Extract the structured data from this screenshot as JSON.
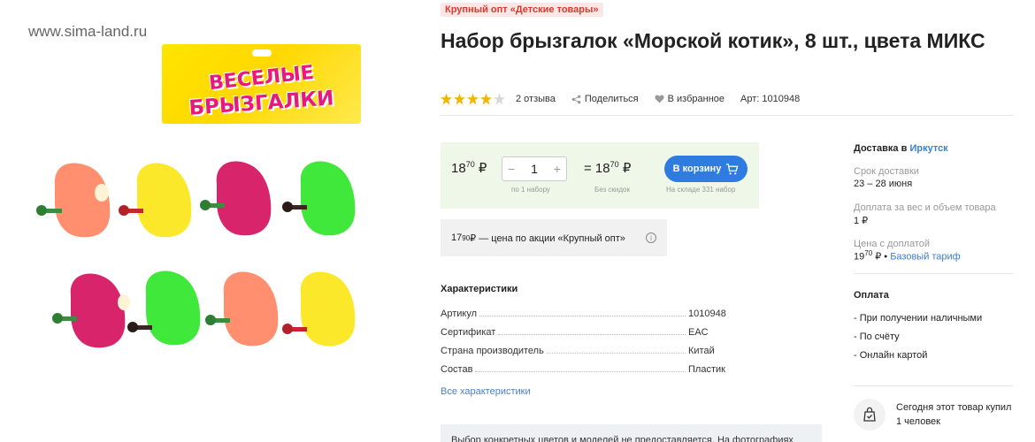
{
  "image": {
    "watermark": "www.sima-land.ru",
    "pack_title_line1": "ВЕСЕЛЫЕ",
    "pack_title_line2": "БРЫЗГАЛКИ"
  },
  "badge": "Крупный опт «Детские товары»",
  "product": {
    "title": "Набор брызгалок «Морской котик», 8 шт., цвета МИКС",
    "rating": 4,
    "rating_max": 5,
    "reviews": "2 отзыва",
    "share": "Поделиться",
    "favorite": "В избранное",
    "article": "Арт: 1010948"
  },
  "buy": {
    "price_int": "18",
    "price_frac": "70",
    "currency": "₽",
    "qty": "1",
    "minus": "−",
    "plus": "+",
    "total_prefix": "= 18",
    "total_frac": "70",
    "cart_label": "В корзину",
    "per_label": "по 1 набору",
    "discount_label": "Без скидок",
    "stock_label": "На складе 331 набор"
  },
  "promo": {
    "price_int": "17",
    "price_frac": "90",
    "text": " ₽ — цена по акции «Крупный опт»",
    "info": "i"
  },
  "characteristics": {
    "title": "Характеристики",
    "rows": [
      {
        "key": "Артикул",
        "value": "1010948"
      },
      {
        "key": "Сертификат",
        "value": "EAC"
      },
      {
        "key": "Страна производитель",
        "value": "Китай"
      },
      {
        "key": "Состав",
        "value": "Пластик"
      }
    ],
    "all_link": "Все характеристики"
  },
  "notice": "Выбор конкретных цветов и моделей не предоставляется. На фотографиях",
  "delivery": {
    "title_prefix": "Доставка в",
    "city": "Иркутск",
    "term_label": "Срок доставки",
    "term_value": "23 – 28 июня",
    "surcharge_label": "Доплата за вес и объем товара",
    "surcharge_value": "1 ₽",
    "price_label": "Цена с доплатой",
    "price_int": "19",
    "price_frac": "70",
    "price_suffix": " ₽ •",
    "tariff_link": "Базовый тариф"
  },
  "payment": {
    "title": "Оплата",
    "items": [
      "- При получении наличными",
      "- По счёту",
      "- Онлайн картой"
    ]
  },
  "bought": {
    "line1": "Сегодня этот товар купил",
    "line2": "1 человек"
  },
  "colors": {
    "accent": "#2f7ce1",
    "star": "#f4b400",
    "buy_bg": "#eef7e8",
    "badge_text": "#d83a2c"
  }
}
